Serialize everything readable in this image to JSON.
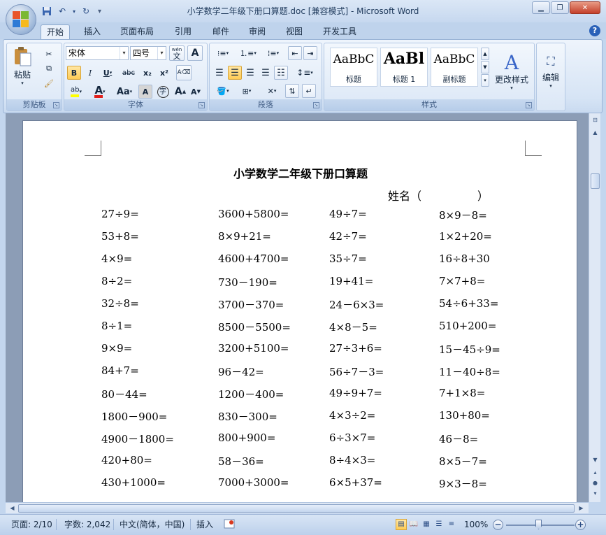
{
  "window": {
    "title": "小学数学二年级下册口算题.doc [兼容模式] - Microsoft Word"
  },
  "tabs": [
    "开始",
    "插入",
    "页面布局",
    "引用",
    "邮件",
    "审阅",
    "视图",
    "开发工具"
  ],
  "ribbon": {
    "clipboard": {
      "label": "剪贴板",
      "paste_label": "粘贴"
    },
    "font": {
      "label": "字体",
      "font_name": "宋体",
      "font_size": "四号",
      "pinyin_glyph": "wén",
      "pinyin_char": "文",
      "bold": "B",
      "italic": "I",
      "underline": "U",
      "strike": "abc",
      "subscript": "x₂",
      "superscript": "x²",
      "font_color": "A",
      "change_case": "Aa",
      "char_shading": "A",
      "enclose": "字",
      "grow": "A",
      "shrink": "A"
    },
    "paragraph": {
      "label": "段落"
    },
    "styles": {
      "label": "样式",
      "items": [
        {
          "sample": "AaBbC",
          "name": "标题"
        },
        {
          "sample": "AaBl",
          "name": "标题 1"
        },
        {
          "sample": "AaBbC",
          "name": "副标题"
        }
      ],
      "change_styles_label": "更改样式"
    },
    "editing": {
      "label": "编辑"
    }
  },
  "document": {
    "title": "小学数学二年级下册口算题",
    "name_field": "姓名（　　　　　）",
    "rows": [
      [
        "27÷9=",
        "3600+5800=",
        "49÷7=",
        "8×9－8="
      ],
      [
        "53+8=",
        "8×9+21=",
        "42÷7=",
        "1×2+20="
      ],
      [
        "4×9=",
        "4600+4700=",
        "35÷7=",
        "16÷8+30"
      ],
      [
        "8÷2=",
        "730－190=",
        "19+41=",
        "7×7+8="
      ],
      [
        "32÷8=",
        "3700－370=",
        "24－6×3=",
        "54÷6+33="
      ],
      [
        "8÷1=",
        "8500－5500=",
        "4×8－5=",
        "510+200="
      ],
      [
        "9×9=",
        "3200+5100=",
        "27÷3+6=",
        "15－45÷9="
      ],
      [
        "84+7=",
        "96－42=",
        "56÷7－3=",
        "11－40÷8="
      ],
      [
        "80－44=",
        "1200－400=",
        "49÷9+7=",
        "7+1×8="
      ],
      [
        "1800－900=",
        "830－300=",
        "4×3÷2=",
        "130+80="
      ],
      [
        "4900－1800=",
        "800+900=",
        "6÷3×7=",
        "46－8="
      ],
      [
        "420+80=",
        "58－36=",
        "8÷4×3=",
        "8×5－7="
      ],
      [
        "430+1000=",
        "7000+3000=",
        "6×5+37=",
        "9×3－8="
      ]
    ]
  },
  "status": {
    "page": "页面: 2/10",
    "words": "字数: 2,042",
    "language": "中文(简体，中国)",
    "mode": "插入",
    "zoom": "100%"
  }
}
